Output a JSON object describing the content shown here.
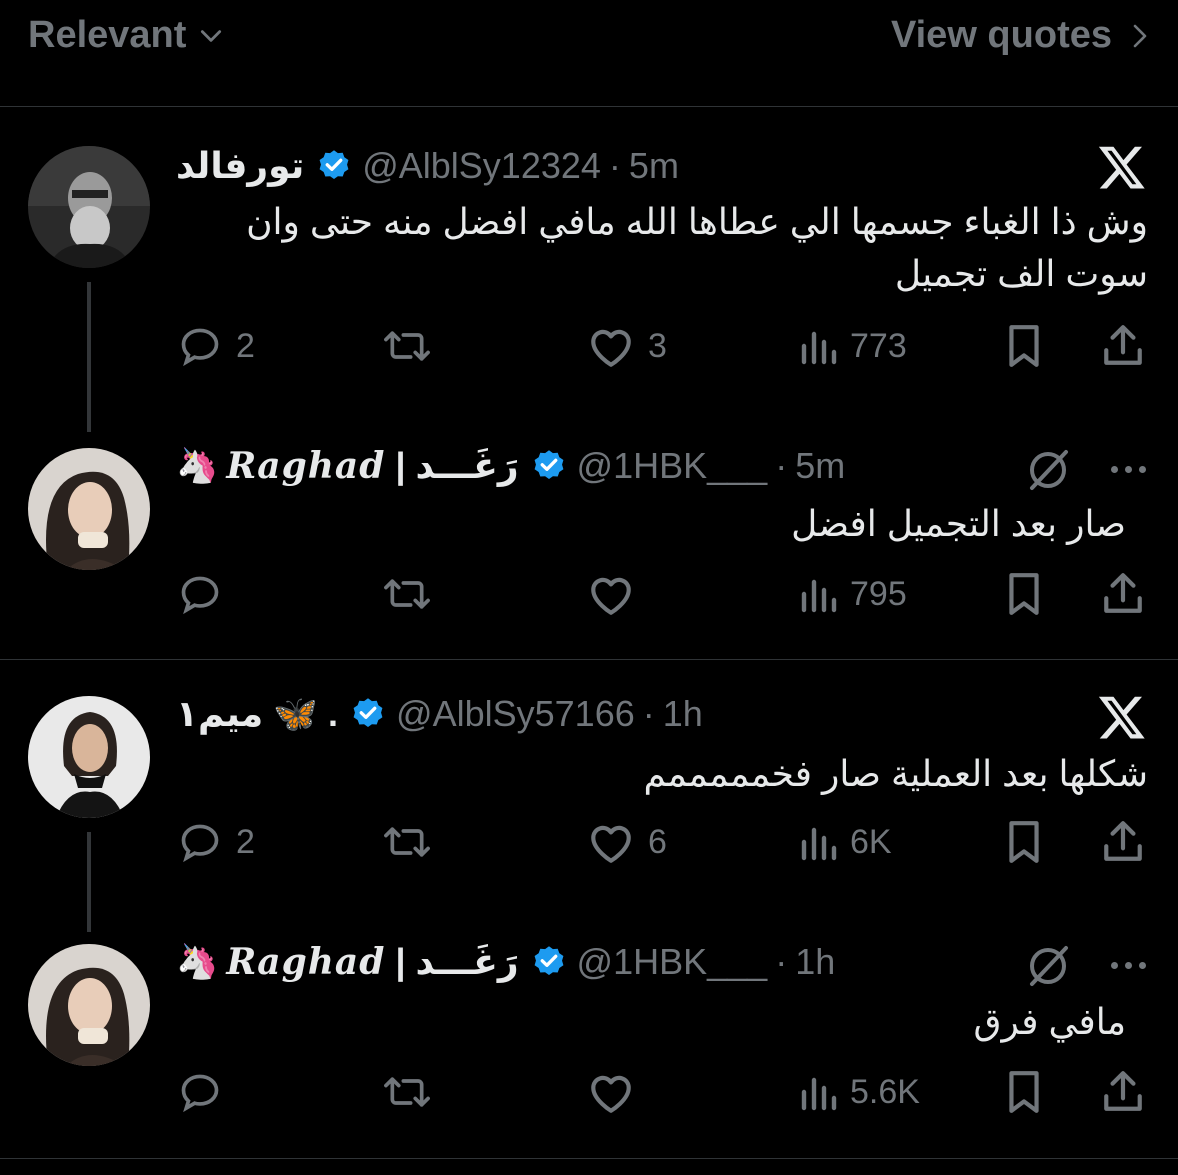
{
  "topbar": {
    "sort_label": "Relevant",
    "view_quotes_label": "View quotes"
  },
  "threads": [
    {
      "tweets": [
        {
          "name": "تورفالد",
          "handle": "@AlblSy12324",
          "time": "5m",
          "text": "وش ذا الغباء جسمها الي عطاها الله مافي افضل منه حتى وان سوت الف تجميل",
          "replies": "2",
          "retweets": "",
          "likes": "3",
          "views": "773"
        },
        {
          "name_emoji": "🦄",
          "name_latin": "𝑹𝒂𝒈𝒉𝒂𝒅",
          "name_sep": "|",
          "name_arabic": "رَغَـــد",
          "handle": "@1HBK___",
          "time": "5m",
          "text": "صار بعد التجميل افضل",
          "replies": "",
          "retweets": "",
          "likes": "",
          "views": "795"
        }
      ]
    },
    {
      "tweets": [
        {
          "name": "ميم١ 🦋 .",
          "handle": "@AlblSy57166",
          "time": "1h",
          "text": "شكلها بعد العملية صار فخمممممم",
          "replies": "2",
          "retweets": "",
          "likes": "6",
          "views": "6K"
        },
        {
          "name_emoji": "🦄",
          "name_latin": "𝑹𝒂𝒈𝒉𝒂𝒅",
          "name_sep": "|",
          "name_arabic": "رَغَـــد",
          "handle": "@1HBK___",
          "time": "1h",
          "text": "مافي فرق",
          "replies": "",
          "retweets": "",
          "likes": "",
          "views": "5.6K"
        }
      ]
    }
  ],
  "colors": {
    "background": "#000000",
    "text": "#e7e9ea",
    "muted": "#71767b",
    "verified": "#1d9bf0",
    "divider": "#2f3336"
  }
}
